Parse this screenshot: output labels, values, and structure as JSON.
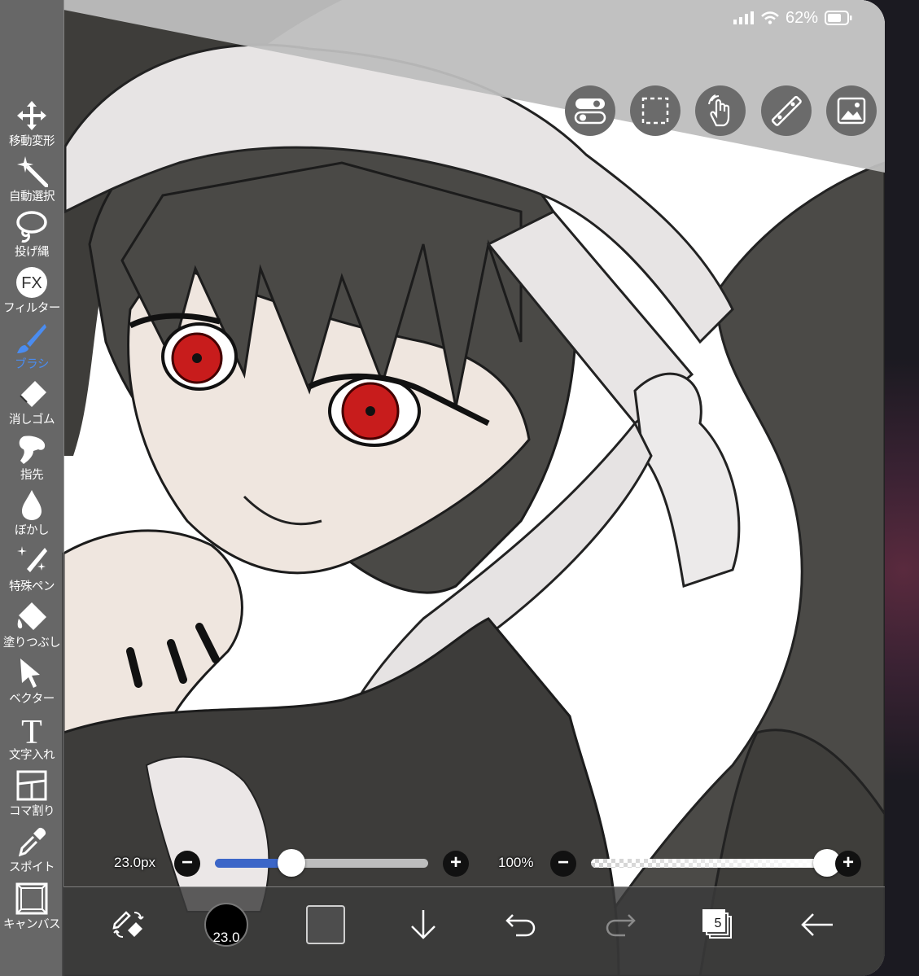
{
  "status_bar": {
    "battery_percent": "62%",
    "icons": [
      "signal-icon",
      "wifi-icon",
      "battery-icon"
    ]
  },
  "top_buttons": [
    "toggle-icon",
    "selection-icon",
    "gesture-icon",
    "ruler-icon",
    "image-icon"
  ],
  "tools": [
    {
      "label": "移動変形",
      "icon": "move-icon"
    },
    {
      "label": "自動選択",
      "icon": "magic-wand-icon"
    },
    {
      "label": "投げ縄",
      "icon": "lasso-icon"
    },
    {
      "label": "フィルター",
      "icon": "fx-icon",
      "icon_text": "FX"
    },
    {
      "label": "ブラシ",
      "icon": "brush-icon",
      "active": true
    },
    {
      "label": "消しゴム",
      "icon": "eraser-icon"
    },
    {
      "label": "指先",
      "icon": "finger-icon"
    },
    {
      "label": "ぼかし",
      "icon": "blur-icon"
    },
    {
      "label": "特殊ペン",
      "icon": "special-pen-icon"
    },
    {
      "label": "塗りつぶし",
      "icon": "fill-icon"
    },
    {
      "label": "ベクター",
      "icon": "vector-icon"
    },
    {
      "label": "文字入れ",
      "icon": "text-icon",
      "icon_text": "T"
    },
    {
      "label": "コマ割り",
      "icon": "frame-divide-icon"
    },
    {
      "label": "スポイト",
      "icon": "eyedropper-icon"
    },
    {
      "label": "キャンバス",
      "icon": "canvas-icon"
    }
  ],
  "brush_size": {
    "label": "23.0px",
    "minus": "−",
    "plus": "+",
    "fraction": 0.36
  },
  "opacity": {
    "label": "100%",
    "minus": "−",
    "plus": "+",
    "fraction": 1.0
  },
  "bottom_bar": {
    "brush_size_badge": "23.0",
    "layer_count": "5",
    "current_color": "#4d4d4d",
    "accent_color": "#4a8cf0",
    "items": [
      "swap-pen-eraser-icon",
      "brush-size-icon",
      "color-swatch",
      "download-icon",
      "undo-icon",
      "redo-icon",
      "layers-icon",
      "back-arrow-icon"
    ]
  }
}
